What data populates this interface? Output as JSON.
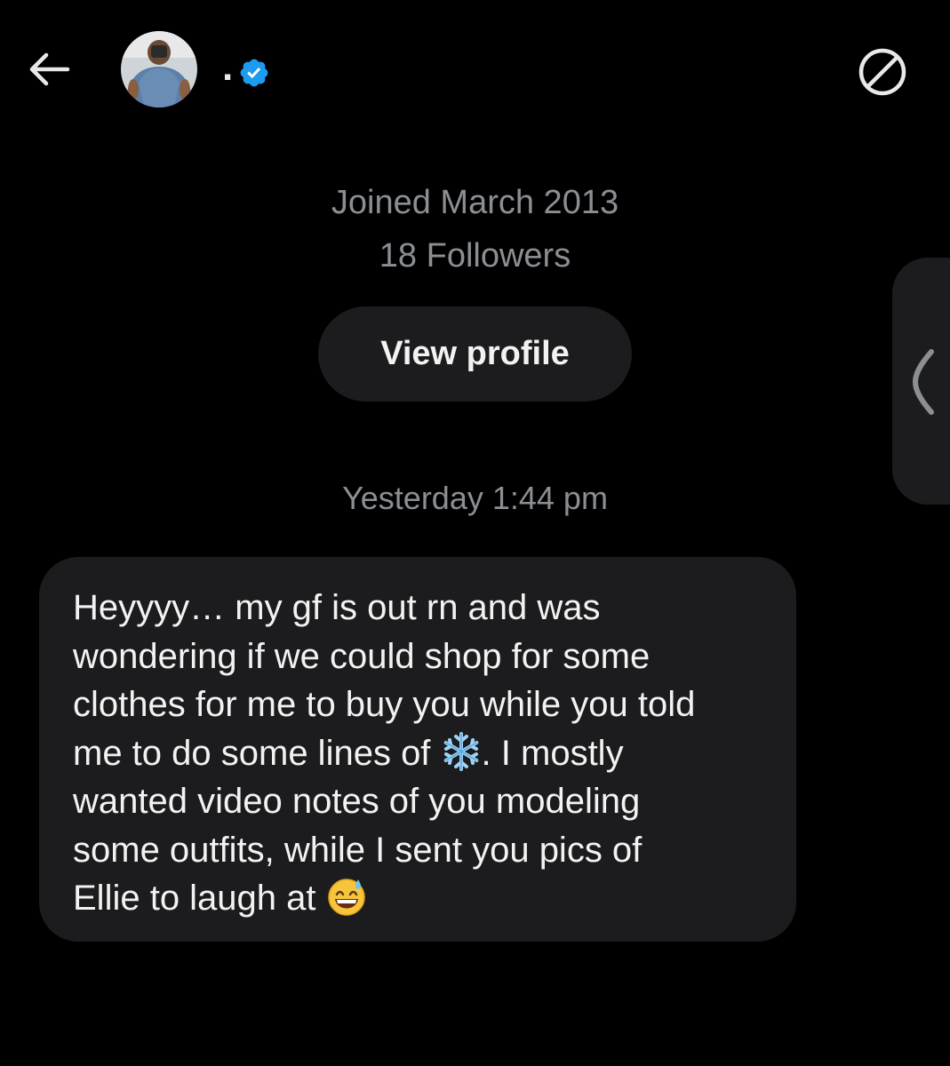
{
  "header": {
    "display_name": ".",
    "back_icon": "back-arrow-icon",
    "verified_icon": "verified-badge-icon",
    "block_icon": "block-icon"
  },
  "profile_info": {
    "joined": "Joined March 2013",
    "followers": "18 Followers",
    "view_profile_label": "View profile"
  },
  "conversation": {
    "timestamp": "Yesterday 1:44 pm",
    "message": {
      "line1": "Heyyyy… my gf is out rn and was",
      "line2": "wondering if we could shop for some",
      "line3": "clothes for me to buy you while you told",
      "line4a": "me to do some lines of ",
      "line4b": ". I mostly",
      "line5": "wanted video notes of you modeling",
      "line6": "some outfits, while I sent you pics of",
      "line7": "Ellie to laugh at ",
      "emoji1": "snowflake-emoji",
      "emoji2": "grinning-face-with-sweat-emoji"
    }
  },
  "colors": {
    "background": "#000000",
    "bubble": "#1c1c1e",
    "secondary_text": "#8b8f94",
    "verified_blue": "#1d9bf0"
  }
}
